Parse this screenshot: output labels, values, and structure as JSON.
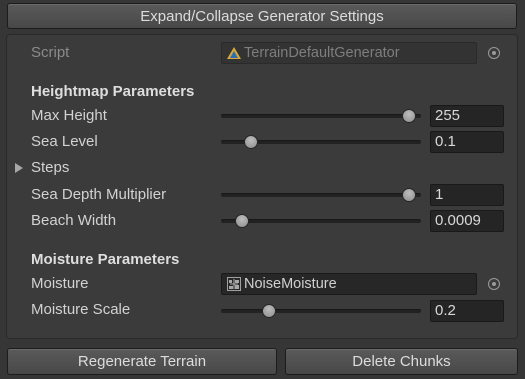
{
  "expand_button": "Expand/Collapse Generator Settings",
  "script": {
    "label": "Script",
    "value": "TerrainDefaultGenerator",
    "icon": "csharp-script-icon"
  },
  "heightmap": {
    "header": "Heightmap Parameters",
    "max_height": {
      "label": "Max Height",
      "value": "255",
      "fraction": 0.98
    },
    "sea_level": {
      "label": "Sea Level",
      "value": "0.1",
      "fraction": 0.12
    },
    "steps": {
      "label": "Steps",
      "expanded": false
    },
    "sea_depth_multiplier": {
      "label": "Sea Depth Multiplier",
      "value": "1",
      "fraction": 0.98
    },
    "beach_width": {
      "label": "Beach Width",
      "value": "0.0009",
      "fraction": 0.07
    }
  },
  "moisture": {
    "header": "Moisture Parameters",
    "moisture": {
      "label": "Moisture",
      "value": "NoiseMoisture",
      "icon": "scriptable-object-icon"
    },
    "moisture_scale": {
      "label": "Moisture Scale",
      "value": "0.2",
      "fraction": 0.22
    }
  },
  "buttons": {
    "regenerate": "Regenerate Terrain",
    "delete_chunks": "Delete Chunks"
  },
  "colors": {
    "background": "#363636",
    "panel": "#3b3b3b",
    "field": "#252525",
    "text": "#d2d2d2",
    "script_icon": "#d9a93a"
  }
}
